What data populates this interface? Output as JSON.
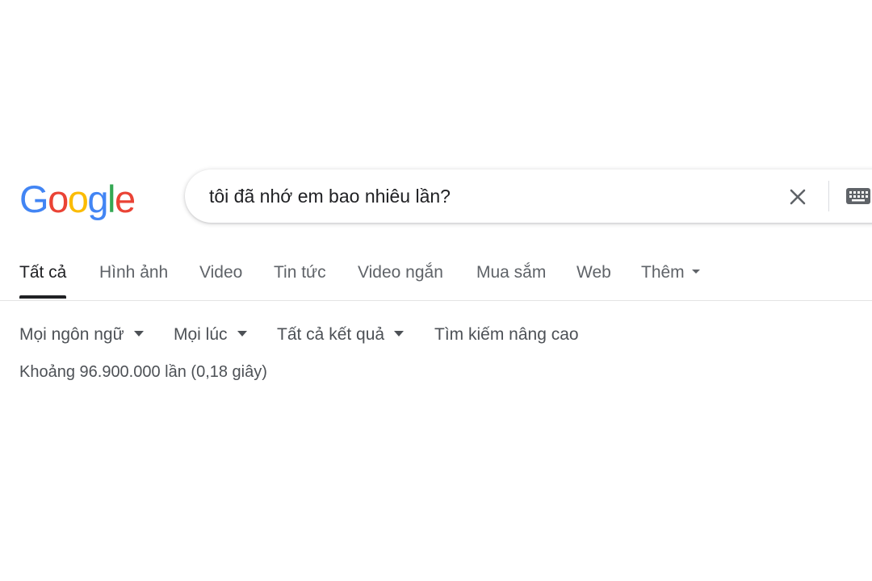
{
  "logo": {
    "letters": [
      {
        "char": "G",
        "color": "#4285F4"
      },
      {
        "char": "o",
        "color": "#EA4335"
      },
      {
        "char": "o",
        "color": "#FBBC05"
      },
      {
        "char": "g",
        "color": "#4285F4"
      },
      {
        "char": "l",
        "color": "#34A853"
      },
      {
        "char": "e",
        "color": "#EA4335"
      }
    ]
  },
  "search": {
    "value": "tôi đã nhớ em bao nhiêu lần?",
    "clear_icon": "close-icon",
    "keyboard_icon": "keyboard-icon"
  },
  "tabs": [
    {
      "label": "Tất cả",
      "active": true
    },
    {
      "label": "Hình ảnh",
      "active": false
    },
    {
      "label": "Video",
      "active": false
    },
    {
      "label": "Tin tức",
      "active": false
    },
    {
      "label": "Video ngắn",
      "active": false
    },
    {
      "label": "Mua sắm",
      "active": false
    },
    {
      "label": "Web",
      "active": false
    },
    {
      "label": "Thêm",
      "active": false
    }
  ],
  "tools": {
    "language": "Mọi ngôn ngữ",
    "time": "Mọi lúc",
    "results": "Tất cả kết quả",
    "advanced": "Tìm kiếm nâng cao"
  },
  "stats": "Khoảng 96.900.000 lần (0,18 giây)",
  "colors": {
    "text_primary": "#202124",
    "text_secondary": "#5f6368",
    "divider": "#e4e4e4"
  }
}
